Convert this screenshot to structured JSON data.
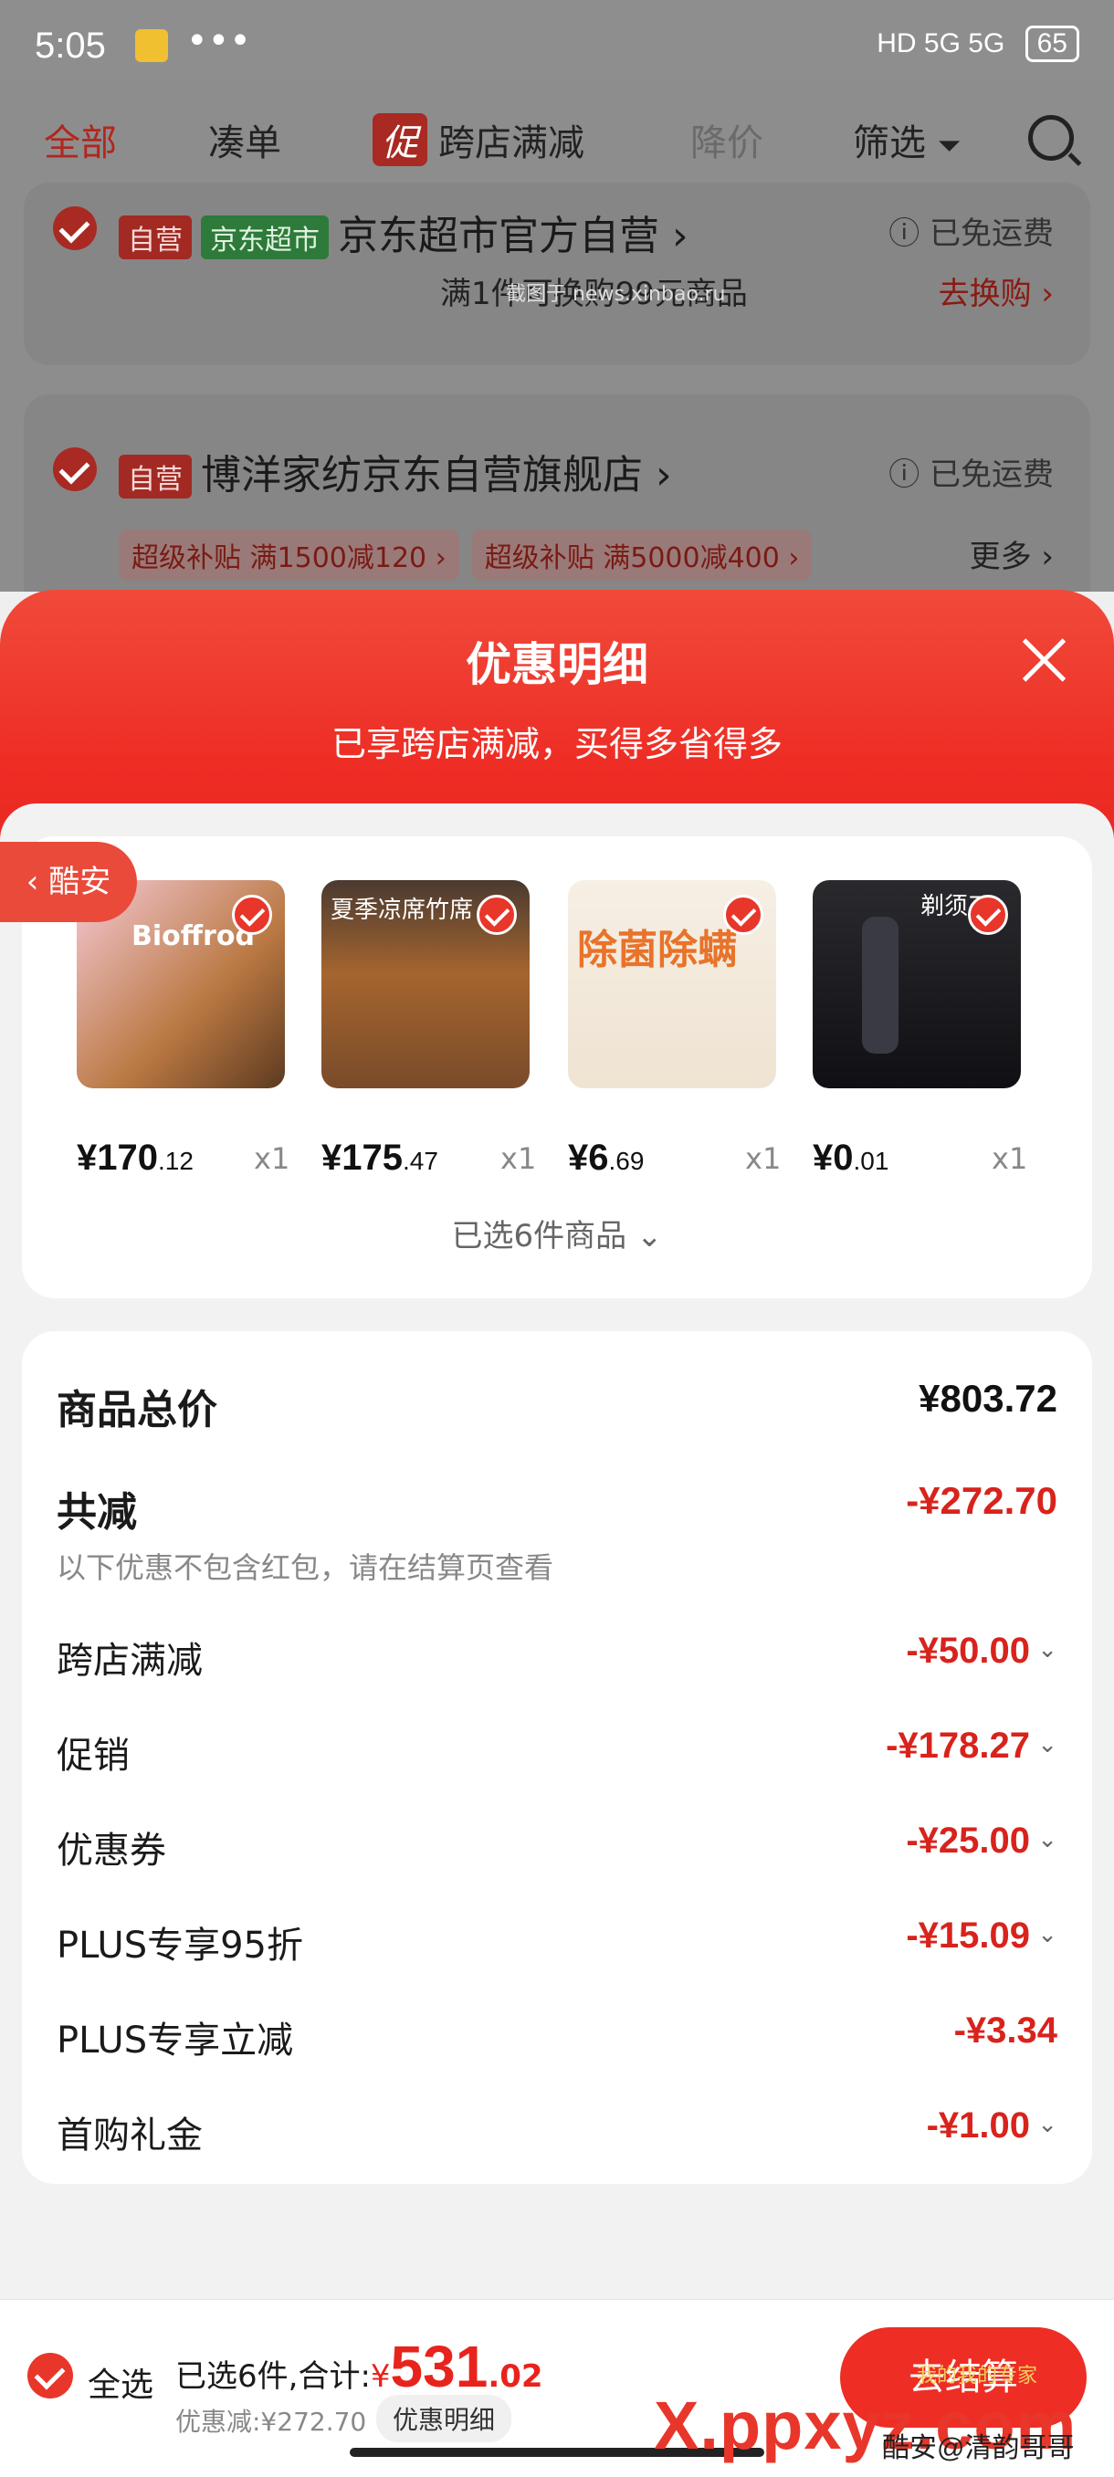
{
  "status_bar": {
    "time": "5:05",
    "more": "•••",
    "network": "HD 5G 5G",
    "battery": "65"
  },
  "nav": {
    "tabs": [
      {
        "label": "全部"
      },
      {
        "label": "凑单"
      },
      {
        "label": "跨店满减",
        "badge": "促"
      },
      {
        "label": "降价"
      },
      {
        "label": "筛选"
      }
    ]
  },
  "stores": [
    {
      "tags": [
        "自营",
        "京东超市"
      ],
      "name": "京东超市官方自营",
      "ship": "已免运费",
      "line2": "满1件可换购99元商品",
      "action": "去换购"
    },
    {
      "tags": [
        "自营"
      ],
      "name": "博洋家纺京东自营旗舰店",
      "ship": "已免运费",
      "subsidies": [
        "超级补贴 满1500减120",
        "超级补贴 满5000减400"
      ],
      "more": "更多"
    }
  ],
  "watermark_top": "截图于 news.xinbao.ru",
  "sheet": {
    "title": "优惠明细",
    "subtitle": "已享跨店满减，买得多省得多",
    "floating_tab": "酷安",
    "products": [
      {
        "price_int": "¥170",
        "price_dec": ".12",
        "qty": "x1",
        "thumb_text": "Bioffrod",
        "color": "#6b4a2e"
      },
      {
        "price_int": "¥175",
        "price_dec": ".47",
        "qty": "x1",
        "thumb_text": "夏季凉席竹席",
        "color": "#7a4b2a"
      },
      {
        "price_int": "¥6",
        "price_dec": ".69",
        "qty": "x1",
        "thumb_text": "除菌除螨",
        "color": "#e8732a"
      },
      {
        "price_int": "¥0",
        "price_dec": ".01",
        "qty": "x1",
        "thumb_text": "剃须刀",
        "color": "#202024"
      }
    ],
    "selected_note": "已选6件商品",
    "summary": {
      "total_label": "商品总价",
      "total_value": "¥803.72",
      "reduce_label": "共减",
      "reduce_value": "-¥272.70",
      "note": "以下优惠不包含红包，请在结算页查看",
      "items": [
        {
          "label": "跨店满减",
          "value": "-¥50.00"
        },
        {
          "label": "促销",
          "value": "-¥178.27"
        },
        {
          "label": "优惠券",
          "value": "-¥25.00"
        },
        {
          "label": "PLUS专享95折",
          "value": "-¥15.09"
        },
        {
          "label": "PLUS专享立减",
          "value": "-¥3.34"
        },
        {
          "label": "首购礼金",
          "value": "-¥1.00"
        }
      ]
    }
  },
  "bottom": {
    "select_all": "全选",
    "selected": "已选6件,合计:",
    "currency": "¥",
    "amount_int": "531",
    "amount_dec": ".02",
    "discount": "优惠减:¥272.70",
    "detail_btn": "优惠明细",
    "checkout": "去结算"
  },
  "watermarks": {
    "site": "X.ppxyz.com",
    "credit": "酷安@清韵哥哥",
    "badge": "我的我的专家"
  },
  "colors": {
    "accent": "#ee2d25",
    "price_red": "#d8231c"
  }
}
